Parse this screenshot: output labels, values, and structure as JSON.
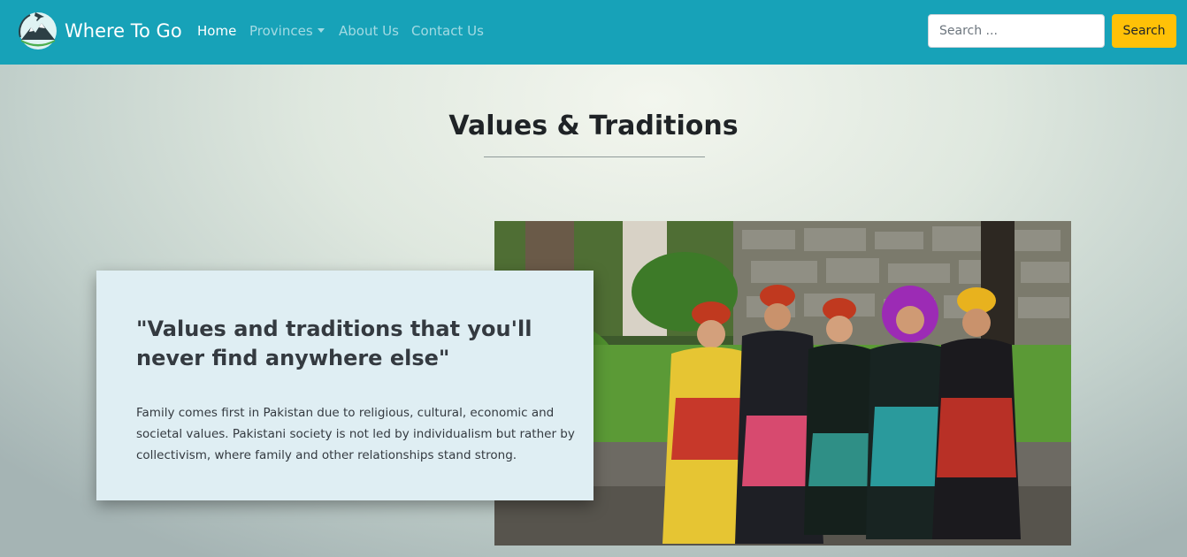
{
  "navbar": {
    "brand_name": "Where To Go",
    "links": [
      {
        "label": "Home",
        "active": true
      },
      {
        "label": "Provinces",
        "dropdown": true
      },
      {
        "label": "About Us"
      },
      {
        "label": "Contact Us"
      }
    ],
    "search": {
      "placeholder": "Search ...",
      "value": "",
      "button_label": "Search"
    },
    "brand_logo_icon": "airplane-mountain-logo-icon"
  },
  "main": {
    "title": "Values & Traditions",
    "quote_heading": "\"Values and traditions that you'll never find anywhere else\"",
    "quote_text": "Family comes first in Pakistan due to religious, cultural, economic and societal values. Pakistani society is not led by individualism but rather by collectivism, where family and other relationships stand strong."
  },
  "colors": {
    "navbar": "#17a2b8",
    "search_button": "#ffc107",
    "card_background": "#dfeef3"
  }
}
